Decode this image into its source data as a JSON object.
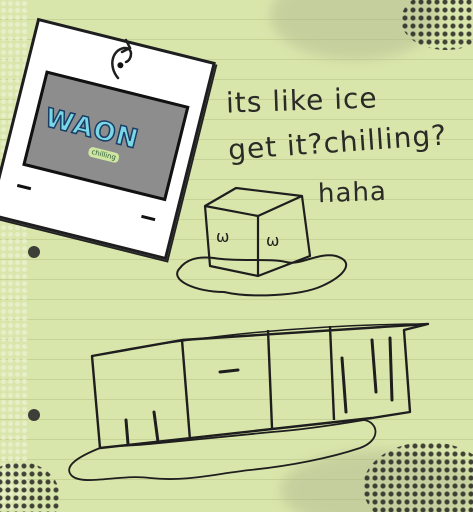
{
  "note": {
    "line1": "its like ice",
    "line2": "get it?chilling?",
    "line3": "haha"
  },
  "polaroid": {
    "logo_text": "WAON",
    "logo_subtitle": "chilling"
  },
  "ice_cube": {
    "face_left": "ω",
    "face_right": "ω"
  }
}
